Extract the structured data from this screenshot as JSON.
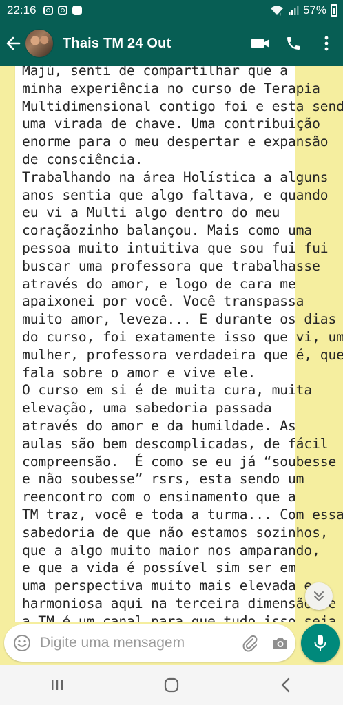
{
  "status_bar": {
    "time": "22:16",
    "battery": "57%",
    "icons": [
      "instagram-icon",
      "instagram-icon",
      "notification-box-icon",
      "wifi-icon",
      "signal-icon",
      "battery-icon"
    ]
  },
  "header": {
    "contact_name": "Thais TM 24 Out",
    "icons": [
      "back-arrow-icon",
      "avatar",
      "video-call-icon",
      "phone-icon",
      "more-vert-icon"
    ]
  },
  "message": {
    "lines": [
      "Majú, senti de compartilhar que a",
      "minha experiência no curso de Terapia",
      "Multidimensional contigo foi e esta sendo",
      "uma virada de chave. Uma contribuição",
      "enorme para o meu despertar e expansão",
      "de consciência.",
      "Trabalhando na área Holística a alguns",
      "anos sentia que algo faltava, e quando",
      "eu vi a Multi algo dentro do meu",
      "coraçãozinho balançou. Mais como uma",
      "pessoa muito intuitiva que sou fui fui",
      "buscar uma professora que trabalhasse",
      "através do amor, e logo de cara me",
      "apaixonei por você. Você transpassa",
      "muito amor, leveza... E durante os dias",
      "do curso, foi exatamente isso que vi, uma",
      "mulher, professora verdadeira que é, que",
      "fala sobre o amor e vive ele.",
      "O curso em si é de muita cura, muita",
      "elevação, uma sabedoria passada",
      "através do amor e da humildade. As",
      "aulas são bem descomplicadas, de fácil",
      "compreensão.  É como se eu já “soubesse",
      "e não soubesse” rsrs, esta sendo um",
      "reencontro com o ensinamento que a",
      "TM traz, você e toda a turma... Com essa",
      "sabedoria de que não estamos sozinhos,",
      "que a algo muito maior nos amparando,",
      "e que a vida é possível sim ser em",
      "uma perspectiva muito mais elevada e",
      "harmoniosa aqui na terceira dimensão, e",
      "a TM é um canal para que tudo isso seja"
    ]
  },
  "composer": {
    "placeholder": "Digite uma mensagem"
  },
  "colors": {
    "header": "#075e54",
    "wallpaper": "#f5ee9f",
    "mic_button": "#00897b"
  }
}
